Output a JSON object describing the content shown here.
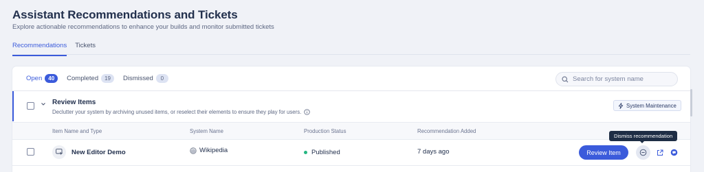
{
  "header": {
    "title": "Assistant Recommendations and Tickets",
    "subtitle": "Explore actionable recommendations to enhance your builds and monitor submitted tickets"
  },
  "main_tabs": [
    {
      "label": "Recommendations",
      "active": true
    },
    {
      "label": "Tickets",
      "active": false
    }
  ],
  "sub_tabs": [
    {
      "label": "Open",
      "count": "40",
      "active": true
    },
    {
      "label": "Completed",
      "count": "19",
      "active": false
    },
    {
      "label": "Dismissed",
      "count": "0",
      "active": false
    }
  ],
  "search": {
    "placeholder": "Search for system name",
    "icon": "search-icon"
  },
  "group": {
    "title": "Review Items",
    "description": "Declutter your system by archiving unused items, or reselect their elements to ensure they play for users.",
    "tag": "System Maintenance",
    "tag_icon": "lightning-icon"
  },
  "columns": {
    "item": "Item Name and Type",
    "system": "System Name",
    "status": "Production Status",
    "added": "Recommendation Added"
  },
  "rows": [
    {
      "item_name": "New Editor Demo",
      "item_icon": "editor-icon",
      "system_name": "Wikipedia",
      "system_icon": "globe-icon",
      "status": "Published",
      "added": "7 days ago",
      "review_label": "Review Item"
    }
  ],
  "tooltip": "Dismiss recommendation",
  "colors": {
    "accent": "#3b5bdb",
    "published": "#25b681",
    "tooltip_bg": "#1e2d45"
  }
}
